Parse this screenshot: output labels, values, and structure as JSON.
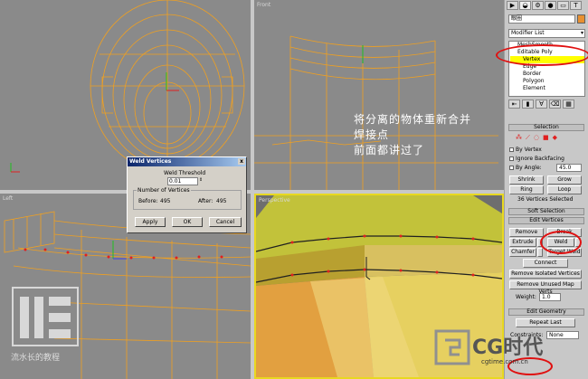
{
  "viewports": {
    "top": {
      "label": ""
    },
    "front": {
      "label": "Front"
    },
    "left": {
      "label": "Left"
    },
    "perspective": {
      "label": "Perspective"
    }
  },
  "overlay_text": {
    "line1": "将分离的物体重新合并",
    "line2": "焊接点",
    "line3": "前面都讲过了"
  },
  "weld_dialog": {
    "title": "Weld Vertices",
    "close": "x",
    "threshold_label": "Weld Threshold",
    "threshold_value": "0.01",
    "group_label": "Number of Vertices",
    "before_label": "Before:",
    "before_value": "495",
    "after_label": "After:",
    "after_value": "495",
    "apply_label": "Apply",
    "ok_label": "OK",
    "cancel_label": "Cancel"
  },
  "panel": {
    "tabs": [
      "▶",
      "◒",
      "⚙",
      "●",
      "▭",
      "T"
    ],
    "object_name": "眼圈",
    "object_color": "#e89030",
    "modifier_list": "Modifier List",
    "stack": [
      "MeshSmooth",
      "Editable Poly",
      "Vertex",
      "Edge",
      "Border",
      "Polygon",
      "Element"
    ],
    "selection_title": "Selection",
    "by_vertex": "By Vertex",
    "ignore_backfacing": "Ignore Backfacing",
    "by_angle": "By Angle:",
    "by_angle_value": "45.0",
    "shrink": "Shrink",
    "grow": "Grow",
    "ring": "Ring",
    "loop": "Loop",
    "vertices_selected": "36 Vertices Selected",
    "soft_selection": "Soft Selection",
    "edit_vertices": "Edit Vertices",
    "remove": "Remove",
    "break": "Break",
    "extrude": "Extrude",
    "weld": "Weld",
    "chamfer": "Chamfer",
    "target_weld": "Target Weld",
    "connect": "Connect",
    "remove_isolated": "Remove Isolated Vertices",
    "remove_unused": "Remove Unused Map Verts",
    "weight_label": "Weight:",
    "weight_value": "1.0",
    "edit_geometry": "Edit Geometry",
    "repeat_last": "Repeat Last",
    "constraints_label": "Constraints:",
    "constraints_value": "None"
  },
  "watermark": {
    "text": "流水长的教程"
  },
  "logo": {
    "text": "CG时代",
    "url": "cgtime.com.cn"
  },
  "colors": {
    "wire": "#f0a020",
    "viewport": "#8a8a8a",
    "highlight": "#ffff00",
    "annotation": "#e01010"
  }
}
